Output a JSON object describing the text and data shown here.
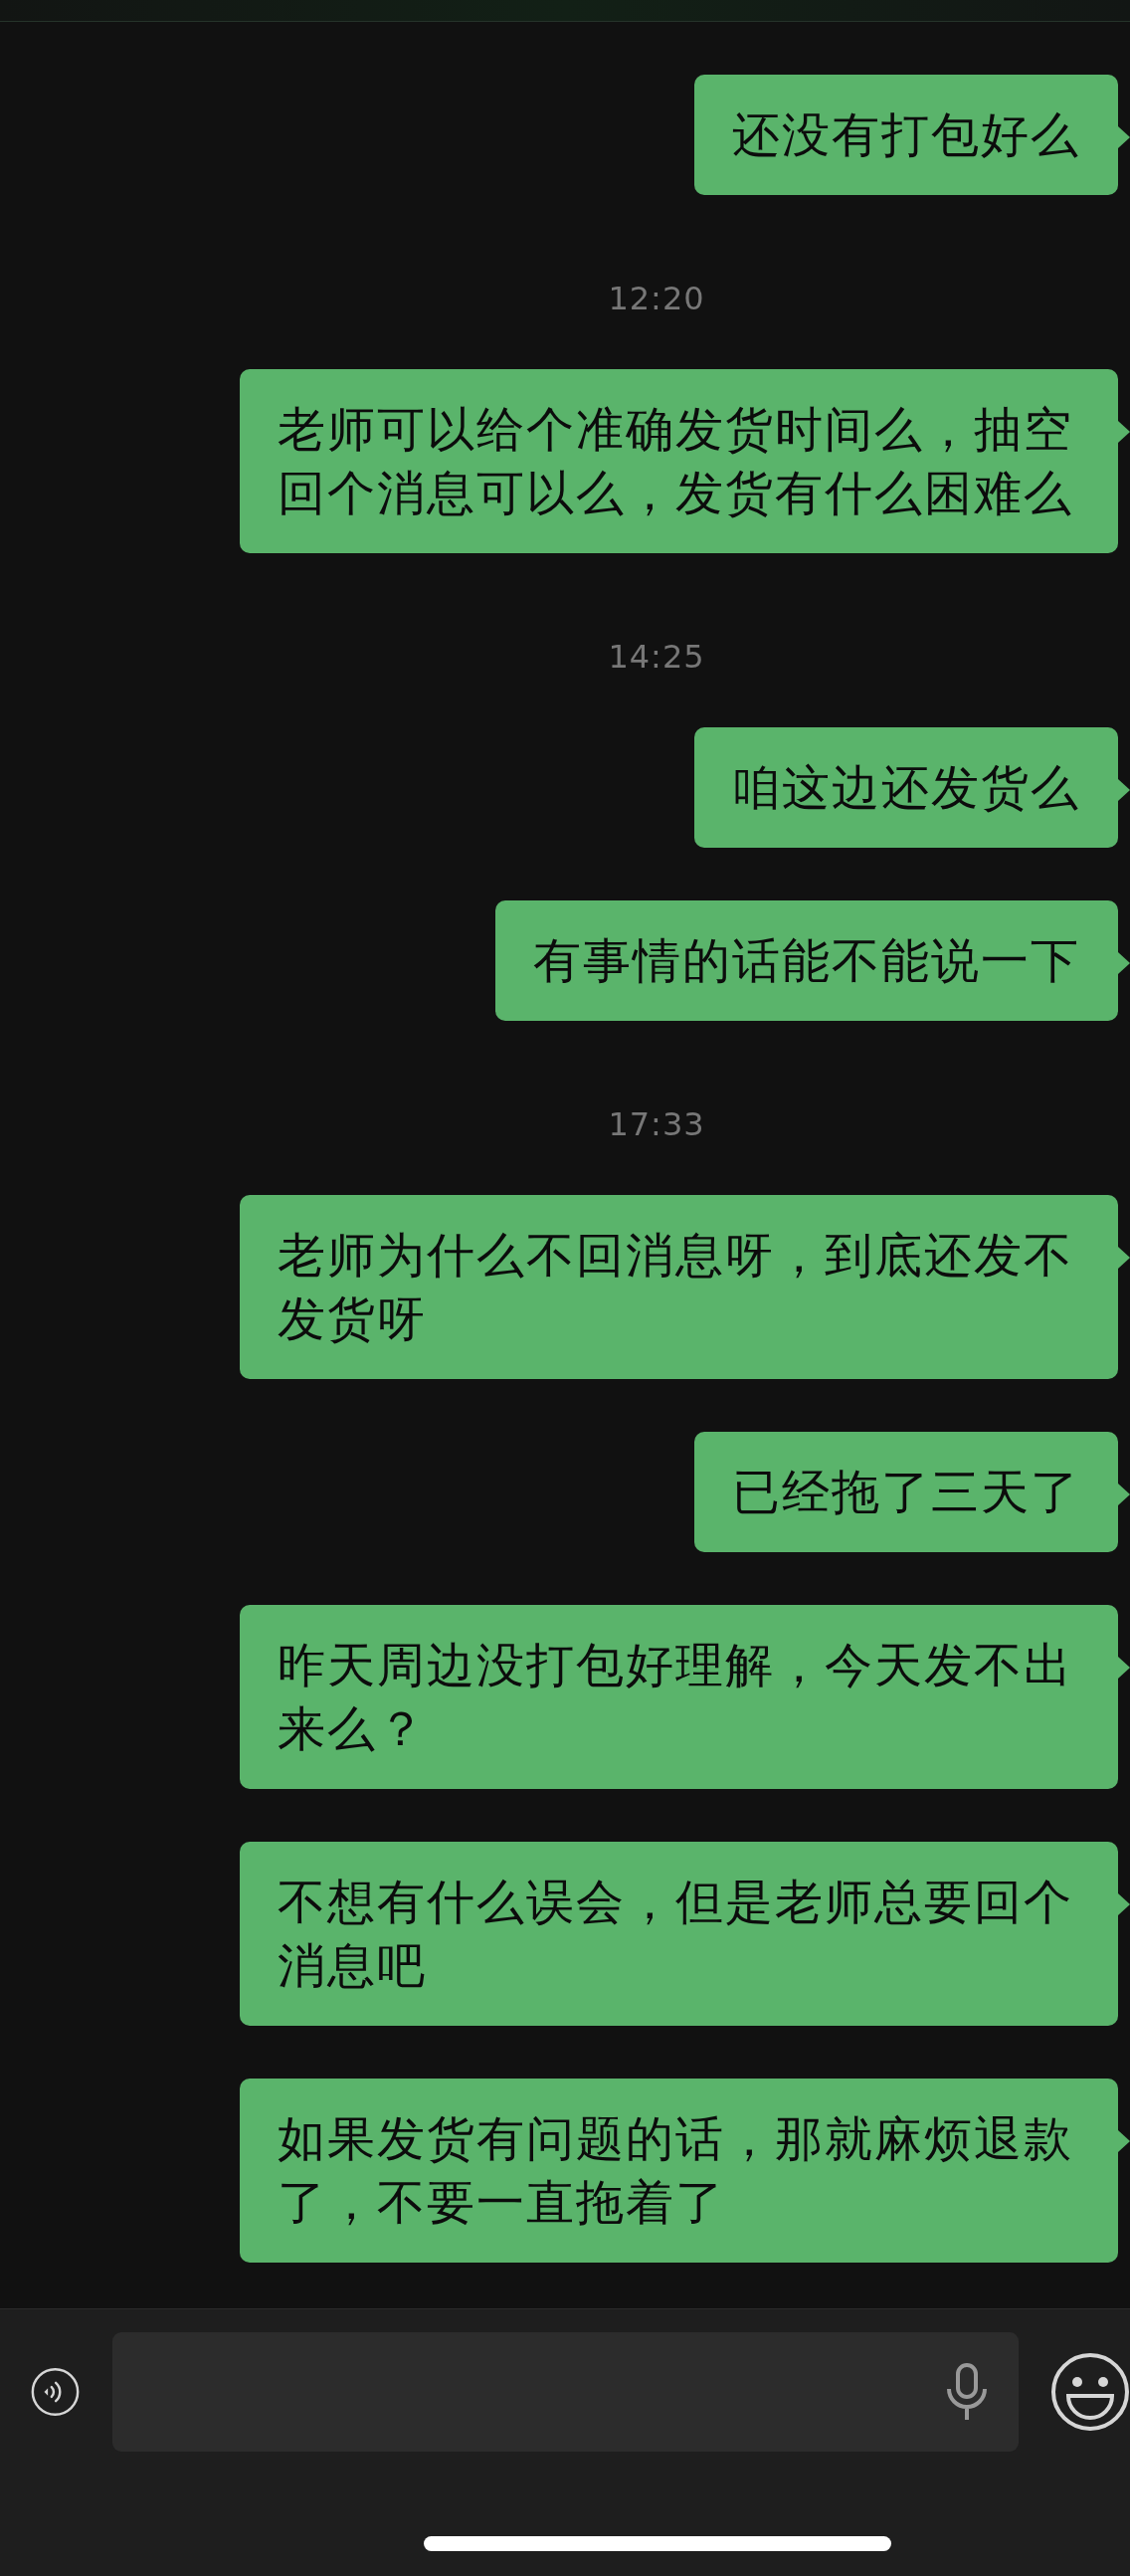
{
  "messages": [
    {
      "kind": "bubble",
      "text": "还没有打包好么"
    },
    {
      "kind": "timestamp",
      "text": "12:20"
    },
    {
      "kind": "bubble",
      "text": "老师可以给个准确发货时间么，抽空回个消息可以么，发货有什么困难么"
    },
    {
      "kind": "timestamp",
      "text": "14:25"
    },
    {
      "kind": "bubble",
      "text": "咱这边还发货么"
    },
    {
      "kind": "bubble",
      "text": "有事情的话能不能说一下"
    },
    {
      "kind": "timestamp",
      "text": "17:33"
    },
    {
      "kind": "bubble",
      "text": "老师为什么不回消息呀，到底还发不发货呀"
    },
    {
      "kind": "bubble",
      "text": "已经拖了三天了"
    },
    {
      "kind": "bubble",
      "text": "昨天周边没打包好理解，今天发不出来么？"
    },
    {
      "kind": "bubble",
      "text": "不想有什么误会，但是老师总要回个消息吧"
    },
    {
      "kind": "bubble",
      "text": "如果发货有问题的话，那就麻烦退款了，不要一直拖着了"
    }
  ]
}
